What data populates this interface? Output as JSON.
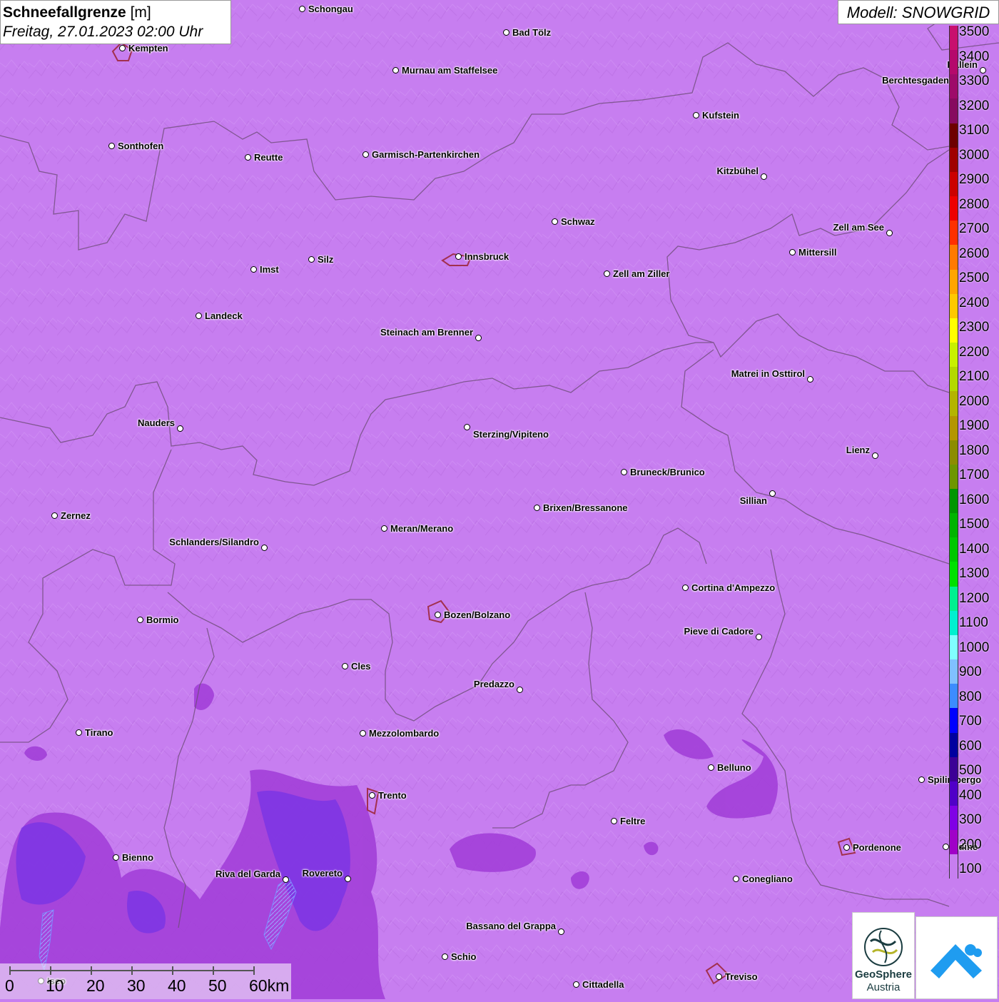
{
  "header": {
    "title_bold": "Schneefallgrenze",
    "title_unit": "[m]",
    "datetime": "Freitag, 27.01.2023 02:00 Uhr",
    "model": "Modell: SNOWGRID"
  },
  "legend": {
    "labels": [
      "3500",
      "3400",
      "3300",
      "3200",
      "3100",
      "3000",
      "2900",
      "2800",
      "2700",
      "2600",
      "2500",
      "2400",
      "2300",
      "2200",
      "2100",
      "2000",
      "1900",
      "1800",
      "1700",
      "1600",
      "1500",
      "1400",
      "1300",
      "1200",
      "1100",
      "1000",
      "900",
      "800",
      "700",
      "600",
      "500",
      "400",
      "300",
      "200",
      "100"
    ],
    "colors": [
      "#c8106e",
      "#b5096c",
      "#9e0a6a",
      "#870a5f",
      "#6e0000",
      "#a00000",
      "#cc0000",
      "#ee0000",
      "#ff3000",
      "#ff7a00",
      "#ffa500",
      "#ffc800",
      "#ffff00",
      "#c8f000",
      "#b4d800",
      "#b4b400",
      "#b49600",
      "#8c8c00",
      "#6e9600",
      "#009600",
      "#00b400",
      "#00c800",
      "#00e000",
      "#00f090",
      "#00f0d0",
      "#80ffff",
      "#80c0ff",
      "#3c8cff",
      "#0000ff",
      "#0000a0",
      "#3c0096",
      "#5000c8",
      "#8000e6",
      "#a000c8",
      "#c77ef0"
    ]
  },
  "cities": [
    {
      "name": "Schongau"
    },
    {
      "name": "Bad Tölz"
    },
    {
      "name": "Kempten"
    },
    {
      "name": "Murnau am Staffelsee"
    },
    {
      "name": "Hallein"
    },
    {
      "name": "Berchtesgaden"
    },
    {
      "name": "Kufstein"
    },
    {
      "name": "Sonthofen"
    },
    {
      "name": "Reutte"
    },
    {
      "name": "Garmisch-Partenkirchen"
    },
    {
      "name": "Kitzbühel"
    },
    {
      "name": "Schwaz"
    },
    {
      "name": "Zell am See"
    },
    {
      "name": "Mittersill"
    },
    {
      "name": "Innsbruck"
    },
    {
      "name": "Imst"
    },
    {
      "name": "Silz"
    },
    {
      "name": "Zell am Ziller"
    },
    {
      "name": "Landeck"
    },
    {
      "name": "Steinach am Brenner"
    },
    {
      "name": "Matrei in Osttirol"
    },
    {
      "name": "Nauders"
    },
    {
      "name": "Sterzing/Vipiteno"
    },
    {
      "name": "Lienz"
    },
    {
      "name": "Bruneck/Brunico"
    },
    {
      "name": "Sillian"
    },
    {
      "name": "Zernez"
    },
    {
      "name": "Brixen/Bressanone"
    },
    {
      "name": "Meran/Merano"
    },
    {
      "name": "Schlanders/Silandro"
    },
    {
      "name": "Cortina d'Ampezzo"
    },
    {
      "name": "Bozen/Bolzano"
    },
    {
      "name": "Bormio"
    },
    {
      "name": "Pieve di Cadore"
    },
    {
      "name": "Cles"
    },
    {
      "name": "Predazzo"
    },
    {
      "name": "Tirano"
    },
    {
      "name": "Mezzolombardo"
    },
    {
      "name": "Belluno"
    },
    {
      "name": "Spilimbergo"
    },
    {
      "name": "Trento"
    },
    {
      "name": "Feltre"
    },
    {
      "name": "Pordenone"
    },
    {
      "name": "Udine"
    },
    {
      "name": "Bienno"
    },
    {
      "name": "Riva del Garda"
    },
    {
      "name": "Rovereto"
    },
    {
      "name": "Conegliano"
    },
    {
      "name": "Bassano del Grappa"
    },
    {
      "name": "Schio"
    },
    {
      "name": "Treviso"
    },
    {
      "name": "Cittadella"
    },
    {
      "name": "Iseo"
    }
  ],
  "scalebar": {
    "labels": [
      "0",
      "10",
      "20",
      "30",
      "40",
      "50",
      "60km"
    ]
  },
  "logos": {
    "geosphere_line1": "GeoSphere",
    "geosphere_line2": "Austria"
  }
}
